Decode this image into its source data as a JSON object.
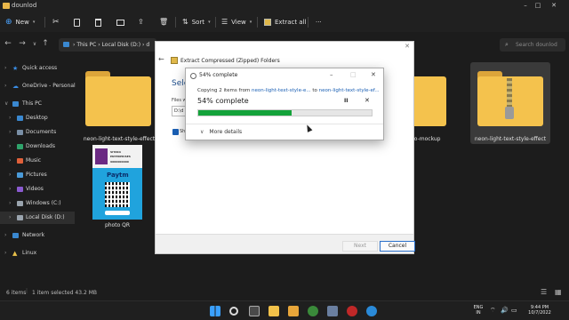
{
  "window": {
    "title": "dounlod",
    "controls": [
      "–",
      "□",
      "✕"
    ]
  },
  "toolbar": {
    "new_label": "New",
    "sort_label": "Sort",
    "view_label": "View",
    "extract_all_label": "Extract all",
    "more_label": "···"
  },
  "address": {
    "path": [
      "This PC",
      "Local Disk (D:)",
      "d"
    ],
    "search_placeholder": "Search dounlod"
  },
  "sidebar": {
    "items": [
      {
        "label": "Quick access",
        "icon": "star-icon",
        "color": "#3a8ee6"
      },
      {
        "label": "OneDrive - Personal",
        "icon": "cloud-icon",
        "color": "#3a8ee6"
      },
      {
        "label": "This PC",
        "icon": "pc-icon",
        "color": "#3a88d0"
      },
      {
        "label": "Desktop",
        "icon": "desktop-icon",
        "color": "#3a88d0"
      },
      {
        "label": "Documents",
        "icon": "documents-icon",
        "color": "#7a8fa6"
      },
      {
        "label": "Downloads",
        "icon": "downloads-icon",
        "color": "#2fa36b"
      },
      {
        "label": "Music",
        "icon": "music-icon",
        "color": "#e0603a"
      },
      {
        "label": "Pictures",
        "icon": "pictures-icon",
        "color": "#4a9ad8"
      },
      {
        "label": "Videos",
        "icon": "videos-icon",
        "color": "#8a5ad0"
      },
      {
        "label": "Windows (C:)",
        "icon": "drive-icon",
        "color": "#9aa4ae"
      },
      {
        "label": "Local Disk (D:)",
        "icon": "drive-icon",
        "color": "#9aa4ae"
      },
      {
        "label": "Network",
        "icon": "network-icon",
        "color": "#3a88d0"
      },
      {
        "label": "Linux",
        "icon": "linux-icon",
        "color": "#e8c04a"
      }
    ]
  },
  "files": [
    {
      "label": "neon-light-text-style-effect"
    },
    {
      "label": "photo QR"
    },
    {
      "label": "go-mockup"
    },
    {
      "label": "neon-light-text-style-effect"
    }
  ],
  "qr_thumb": {
    "header_line1": "SITARA",
    "header_line2": "ENTERPRISES",
    "header_line3": "9000000000",
    "logo": "Paytm"
  },
  "wizard": {
    "title": "Extract Compressed (Zipped) Folders",
    "heading": "Sele",
    "files_label": "Files w",
    "field_value": "D:\\d",
    "checkbox_label": "Sh",
    "next_label": "Next",
    "cancel_label": "Cancel"
  },
  "progress": {
    "title": "54% complete",
    "copy_prefix": "Copying 2 items from ",
    "copy_from": "neon-light-text-style-e...",
    "copy_mid": " to ",
    "copy_to": "neon-light-text-style-ef...",
    "percent_label": "54% complete",
    "percent": 54,
    "more_details": "More details",
    "fill_color": "#14a23a"
  },
  "status": {
    "item_count": "6 items",
    "selection": "1 item selected  43.2 MB"
  },
  "taskbar": {
    "lang_line1": "ENG",
    "lang_line2": "IN",
    "time": "9:44 PM",
    "date": "10/7/2022"
  }
}
